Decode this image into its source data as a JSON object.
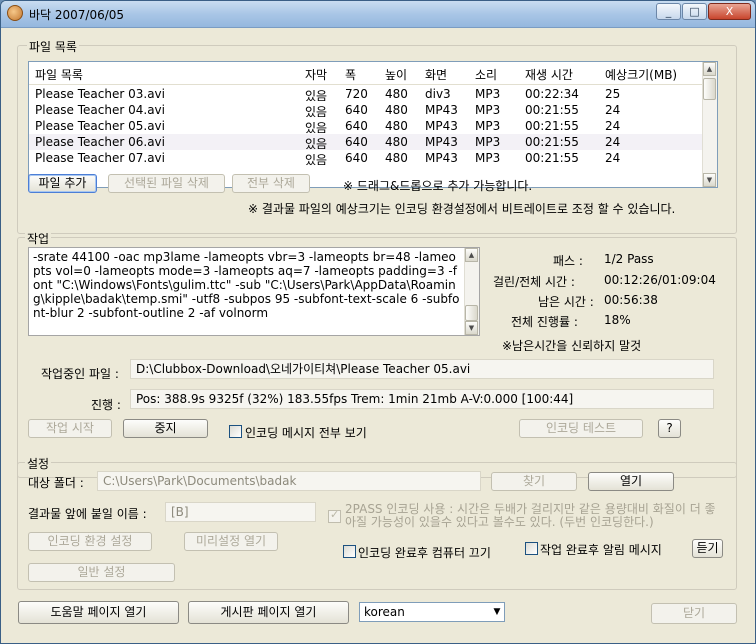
{
  "window": {
    "title": "바닥 2007/06/05",
    "minimize_glyph": "_",
    "maximize_glyph": "□",
    "close_glyph": "X"
  },
  "file_list": {
    "group_label": "파일 목록",
    "columns": [
      "파일 목록",
      "자막",
      "폭",
      "높이",
      "화면",
      "소리",
      "재생 시간",
      "예상크기(MB)"
    ],
    "rows": [
      [
        "Please Teacher 03.avi",
        "있음",
        "720",
        "480",
        "div3",
        "MP3",
        "00:22:34",
        "25"
      ],
      [
        "Please Teacher 04.avi",
        "있음",
        "640",
        "480",
        "MP43",
        "MP3",
        "00:21:55",
        "24"
      ],
      [
        "Please Teacher 05.avi",
        "있음",
        "640",
        "480",
        "MP43",
        "MP3",
        "00:21:55",
        "24"
      ],
      [
        "Please Teacher 06.avi",
        "있음",
        "640",
        "480",
        "MP43",
        "MP3",
        "00:21:55",
        "24"
      ],
      [
        "Please Teacher 07.avi",
        "있음",
        "640",
        "480",
        "MP43",
        "MP3",
        "00:21:55",
        "24"
      ]
    ],
    "add_file_button": "파일 추가",
    "delete_selected_button": "선택된 파일 삭제",
    "delete_all_button": "전부 삭제",
    "drag_hint": "※ 드래그&드롭으로 추가 가능합니다.",
    "size_hint": "※ 결과물 파일의 예상크기는 인코딩 환경설정에서 비트레이트로 조정 할 수 있습니다."
  },
  "job": {
    "group_label": "작업",
    "command": "-srate 44100 -oac mp3lame -lameopts vbr=3 -lameopts br=48 -lameopts vol=0 -lameopts mode=3 -lameopts aq=7 -lameopts padding=3 -font \"C:\\Windows\\Fonts\\gulim.ttc\" -sub \"C:\\Users\\Park\\AppData\\Roaming\\kipple\\badak\\temp.smi\" -utf8 -subpos 95 -subfont-text-scale 6 -subfont-blur 2 -subfont-outline 2 -af volnorm",
    "pass_label": "패스 :",
    "pass_value": "1/2 Pass",
    "elapsed_label": "걸린/전체 시간 :",
    "elapsed_value": "00:12:26/01:09:04",
    "remaining_label": "남은 시간 :",
    "remaining_value": "00:56:38",
    "progress_label": "전체 진행률 :",
    "progress_value": "18%",
    "unreliable_note": "※남은시간을 신뢰하지 말것",
    "current_file_label": "작업중인 파일 :",
    "current_file_value": "D:\\Clubbox-Download\\오네가이티쳐\\Please Teacher 05.avi",
    "status_label": "진행 :",
    "status_value": "Pos: 388.9s   9325f (32%) 183.55fps Trem:   1min   21mb  A-V:0.000 [100:44]",
    "start_button": "작업 시작",
    "stop_button": "중지",
    "show_all_messages_label": "인코딩 메시지 전부 보기",
    "encoding_test_button": "인코딩 테스트",
    "help_button": "?"
  },
  "settings": {
    "group_label": "설정",
    "target_folder_label": "대상 폴더 :",
    "target_folder_value": "C:\\Users\\Park\\Documents\\badak",
    "browse_button": "찾기",
    "open_button": "열기",
    "prefix_label": "결과물 앞에 붙일 이름 :",
    "prefix_value": "[B]",
    "two_pass_label": "2PASS 인코딩 사용 : 시간은 두배가 걸리지만 같은 용량대비 화질이 더 좋아질 가능성이 있을수 있다고 볼수도 있다. (두번 인코딩한다.)",
    "encoding_settings_button": "인코딩 환경 설정",
    "preset_open_button": "미리설정 열기",
    "general_settings_button": "일반 설정",
    "shutdown_after_label": "인코딩 완료후 컴퓨터 끄기",
    "alert_after_label": "작업 완료후 알림 메시지",
    "listen_button": "듣기"
  },
  "bottom": {
    "help_page_button": "도움말 페이지 열기",
    "board_page_button": "게시판 페이지 열기",
    "language_value": "korean",
    "close_button": "닫기"
  }
}
